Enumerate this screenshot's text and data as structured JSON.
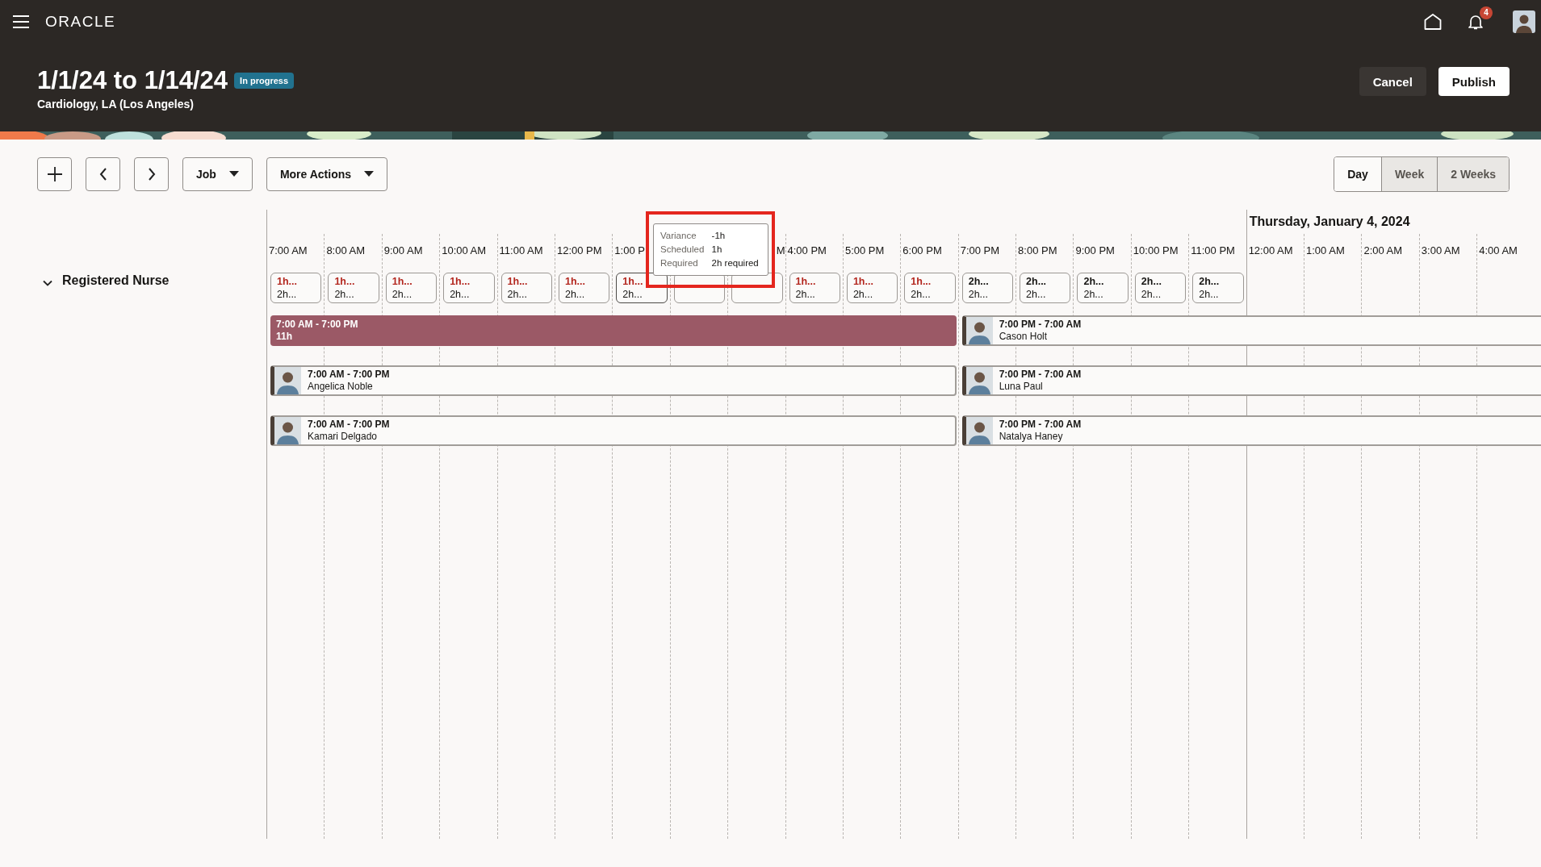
{
  "app": {
    "logo": "ORACLE",
    "notifications": "4"
  },
  "schedule": {
    "title": "1/1/24 to 1/14/24",
    "status": "In progress",
    "subtitle": "Cardiology, LA (Los Angeles)"
  },
  "header_actions": [
    {
      "label": "Cancel",
      "kind": "secondary"
    },
    {
      "label": "Publish",
      "kind": "primary"
    }
  ],
  "toolbar": {
    "dropdowns": [
      {
        "label": "Job"
      },
      {
        "label": "More Actions"
      }
    ]
  },
  "views": [
    {
      "label": "Day",
      "selected": true
    },
    {
      "label": "Week",
      "selected": false
    },
    {
      "label": "2 Weeks",
      "selected": false
    }
  ],
  "group": {
    "label": "Registered Nurse",
    "expanded": true
  },
  "columns": [
    {
      "label": "7:00 AM",
      "slot": {
        "selected": false,
        "short": true,
        "scheduled": "1h...",
        "required": "2h..."
      }
    },
    {
      "label": "8:00 AM",
      "slot": {
        "selected": false,
        "short": true,
        "scheduled": "1h...",
        "required": "2h..."
      }
    },
    {
      "label": "9:00 AM",
      "slot": {
        "selected": false,
        "short": true,
        "scheduled": "1h...",
        "required": "2h..."
      }
    },
    {
      "label": "10:00 AM",
      "slot": {
        "selected": false,
        "short": true,
        "scheduled": "1h...",
        "required": "2h..."
      }
    },
    {
      "label": "11:00 AM",
      "slot": {
        "selected": false,
        "short": true,
        "scheduled": "1h...",
        "required": "2h..."
      }
    },
    {
      "label": "12:00 PM",
      "slot": {
        "selected": false,
        "short": true,
        "scheduled": "1h...",
        "required": "2h..."
      }
    },
    {
      "label": "1:00 P",
      "slot": {
        "selected": true,
        "short": true,
        "scheduled": "1h...",
        "required": "2h..."
      }
    },
    {
      "slot": {
        "selected": false
      }
    },
    {
      "label": "M",
      "cut_at_start": true,
      "slot": {
        "selected": false
      }
    },
    {
      "label": "4:00 PM",
      "slot": {
        "selected": false,
        "short": true,
        "scheduled": "1h...",
        "required": "2h..."
      }
    },
    {
      "label": "5:00 PM",
      "slot": {
        "selected": false,
        "short": true,
        "scheduled": "1h...",
        "required": "2h..."
      }
    },
    {
      "label": "6:00 PM",
      "slot": {
        "selected": false,
        "short": true,
        "scheduled": "1h...",
        "required": "2h..."
      }
    },
    {
      "label": "7:00 PM",
      "slot": {
        "selected": false,
        "short": false,
        "scheduled": "2h...",
        "required": "2h..."
      }
    },
    {
      "label": "8:00 PM",
      "slot": {
        "selected": false,
        "short": false,
        "scheduled": "2h...",
        "required": "2h..."
      }
    },
    {
      "label": "9:00 PM",
      "slot": {
        "selected": false,
        "short": false,
        "scheduled": "2h...",
        "required": "2h..."
      }
    },
    {
      "label": "10:00 PM",
      "slot": {
        "selected": false,
        "short": false,
        "scheduled": "2h...",
        "required": "2h..."
      }
    },
    {
      "label": "11:00 PM",
      "slot": {
        "selected": false,
        "short": false,
        "scheduled": "2h...",
        "required": "2h..."
      }
    },
    {
      "label": "12:00 AM",
      "date": "Thursday, January 4, 2024"
    },
    {
      "label": "1:00 AM"
    },
    {
      "label": "2:00 AM"
    },
    {
      "label": "3:00 AM"
    },
    {
      "label": "4:00 AM"
    }
  ],
  "tooltip": {
    "rows": [
      {
        "label": "Variance",
        "value": "-1h"
      },
      {
        "label": "Scheduled",
        "value": "1h"
      },
      {
        "label": "Required",
        "value": "2h required"
      }
    ]
  },
  "shift_rows": [
    [
      {
        "kind": "open",
        "time": "7:00 AM - 7:00 PM",
        "hours": "11h"
      },
      {
        "kind": "assigned",
        "time": "7:00 PM - 7:00 AM",
        "name": "Cason Holt"
      }
    ],
    [
      {
        "kind": "assigned",
        "time": "7:00 AM - 7:00 PM",
        "name": "Angelica Noble"
      },
      {
        "kind": "assigned",
        "time": "7:00 PM - 7:00 AM",
        "name": "Luna Paul"
      }
    ],
    [
      {
        "kind": "assigned",
        "time": "7:00 AM - 7:00 PM",
        "name": "Kamari Delgado"
      },
      {
        "kind": "assigned",
        "time": "7:00 PM - 7:00 AM",
        "name": "Natalya Haney"
      }
    ]
  ]
}
